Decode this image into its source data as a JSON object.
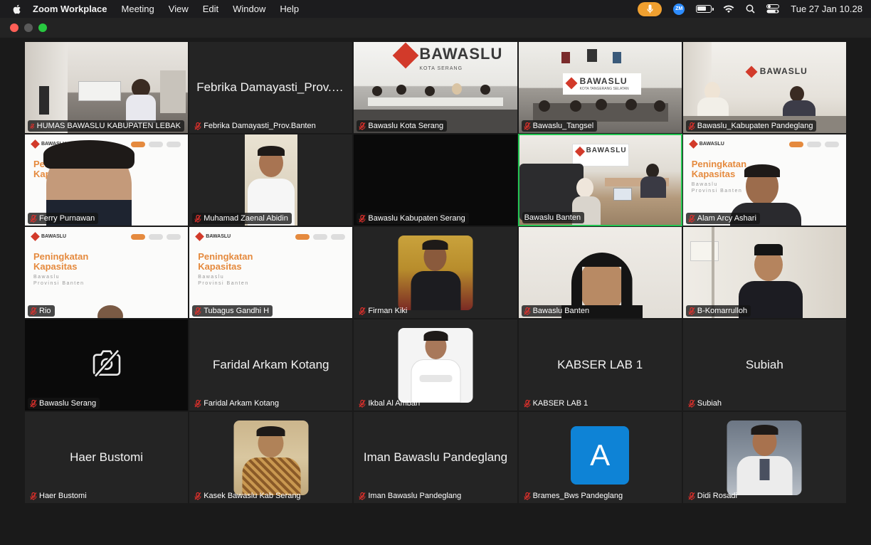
{
  "menubar": {
    "app_name": "Zoom Workplace",
    "menus": [
      "Meeting",
      "View",
      "Edit",
      "Window",
      "Help"
    ],
    "zm_badge": "ZM",
    "clock": "Tue 27 Jan  10.28"
  },
  "window": {
    "traffic_lights": [
      "close",
      "minimize",
      "zoom"
    ]
  },
  "colors": {
    "active_speaker_border": "#23c552",
    "mic_pill": "#f0a030",
    "avatar_bg": "#0e83d6",
    "muted_icon": "#e0302b"
  },
  "slide": {
    "logo_line1": "BAWASLU",
    "logo_line2": "PROVINSI BANTEN",
    "title_line1": "Peningkatan",
    "title_line2": "Kapasitas",
    "sub_line1": "Bawaslu",
    "sub_line2": "Provinsi Banten"
  },
  "scene_text": {
    "bawaslu_logo": "BAWASLU",
    "kota_serang": "KOTA SERANG",
    "kota_tangsel": "KOTA TANGERANG SELATAN"
  },
  "tiles": [
    {
      "name": "HUMAS BAWASLU KABUPATEN LEBAK",
      "kind": "video-office"
    },
    {
      "name": "Febrika Damayasti_Prov.Banten",
      "center": "Febrika Damayasti_Prov.B...",
      "kind": "name-only"
    },
    {
      "name": "Bawaslu Kota Serang",
      "kind": "video-hall"
    },
    {
      "name": "Bawaslu_Tangsel",
      "kind": "video-room"
    },
    {
      "name": "Bawaslu_Kabupaten Pandeglang",
      "kind": "video-room2"
    },
    {
      "name": "Ferry Purnawan",
      "kind": "video-slide-face"
    },
    {
      "name": "Muhamad Zaenal Abidin",
      "kind": "video-portrait"
    },
    {
      "name": "Bawaslu Kabupaten Serang",
      "kind": "black"
    },
    {
      "name": "Bawaslu Banten",
      "kind": "video-meeting",
      "active": true
    },
    {
      "name": "Alam Arcy Ashari",
      "kind": "video-slide-man"
    },
    {
      "name": "Rio",
      "kind": "video-slide"
    },
    {
      "name": "Tubagus Gandhi H",
      "kind": "video-slide"
    },
    {
      "name": "Firman Kiki",
      "kind": "avatar-photo"
    },
    {
      "name": "Bawaslu Banten",
      "kind": "video-woman"
    },
    {
      "name": "B-Komarrulloh",
      "kind": "video-man-peci"
    },
    {
      "name": "Bawaslu Serang",
      "kind": "camera-off"
    },
    {
      "name": "Faridal Arkam Kotang",
      "center": "Faridal Arkam Kotang",
      "kind": "name-only"
    },
    {
      "name": "Ikbal Al Ambari",
      "kind": "avatar-photo-white"
    },
    {
      "name": "KABSER LAB 1",
      "center": "KABSER LAB 1",
      "kind": "name-only"
    },
    {
      "name": "Subiah",
      "center": "Subiah",
      "kind": "name-only"
    },
    {
      "name": "Haer Bustomi",
      "center": "Haer Bustomi",
      "kind": "name-only"
    },
    {
      "name": "Kasek Bawaslu Kab Serang",
      "kind": "avatar-photo-batik"
    },
    {
      "name": "Iman Bawaslu Pandeglang",
      "center": "Iman Bawaslu Pandeglang",
      "kind": "name-only"
    },
    {
      "name": "Brames_Bws Pandeglang",
      "kind": "avatar-letter",
      "letter": "A"
    },
    {
      "name": "Didi Rosadi",
      "kind": "avatar-photo-vest"
    }
  ]
}
